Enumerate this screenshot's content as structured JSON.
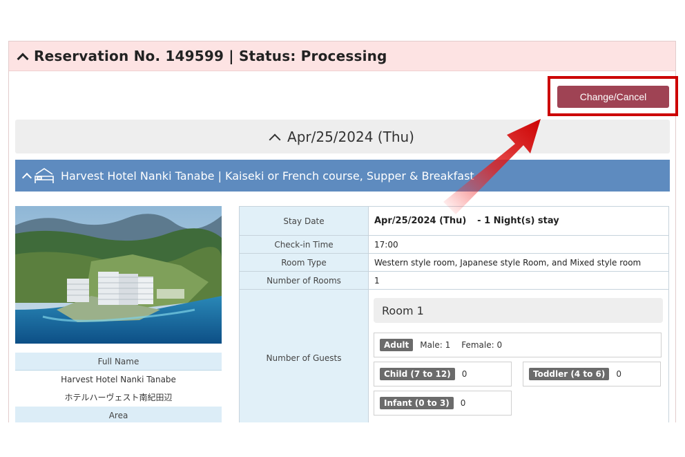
{
  "reservation": {
    "header_title": "Reservation No. 149599 | Status: Processing",
    "change_cancel_label": "Change/Cancel",
    "date_heading": "Apr/25/2024 (Thu)",
    "hotel_heading": "Harvest Hotel Nanki Tanabe | Kaiseki or French course, Supper & Breakfast"
  },
  "hotel_info": {
    "full_name_label": "Full Name",
    "full_name_en": "Harvest Hotel Nanki Tanabe",
    "full_name_jp": "ホテルハーヴェスト南紀田辺",
    "area_label": "Area"
  },
  "details": {
    "stay_date_label": "Stay Date",
    "stay_date_value": "Apr/25/2024 (Thu)",
    "stay_nights": "-  1 Night(s) stay",
    "checkin_label": "Check-in Time",
    "checkin_value": "17:00",
    "room_type_label": "Room Type",
    "room_type_value": "Western style room, Japanese style Room, and Mixed style room",
    "rooms_label": "Number of Rooms",
    "rooms_value": "1",
    "guests_label": "Number of Guests",
    "room_title": "Room 1",
    "adult_tag": "Adult",
    "male_label": "Male:",
    "male_value": "1",
    "female_label": "Female:",
    "female_value": "0",
    "child_tag": "Child (7 to 12)",
    "child_value": "0",
    "toddler_tag": "Toddler (4 to 6)",
    "toddler_value": "0",
    "infant_tag": "Infant (0 to 3)",
    "infant_value": "0"
  },
  "colors": {
    "header_bg": "#fde3e3",
    "button_bg": "#9f4354",
    "highlight": "#cc0000",
    "hotel_bar": "#5e8bbf",
    "label_cell": "#e1f0f8"
  },
  "icons": [
    "chevron-up-icon",
    "bed-icon",
    "arrow-annotation-icon"
  ]
}
